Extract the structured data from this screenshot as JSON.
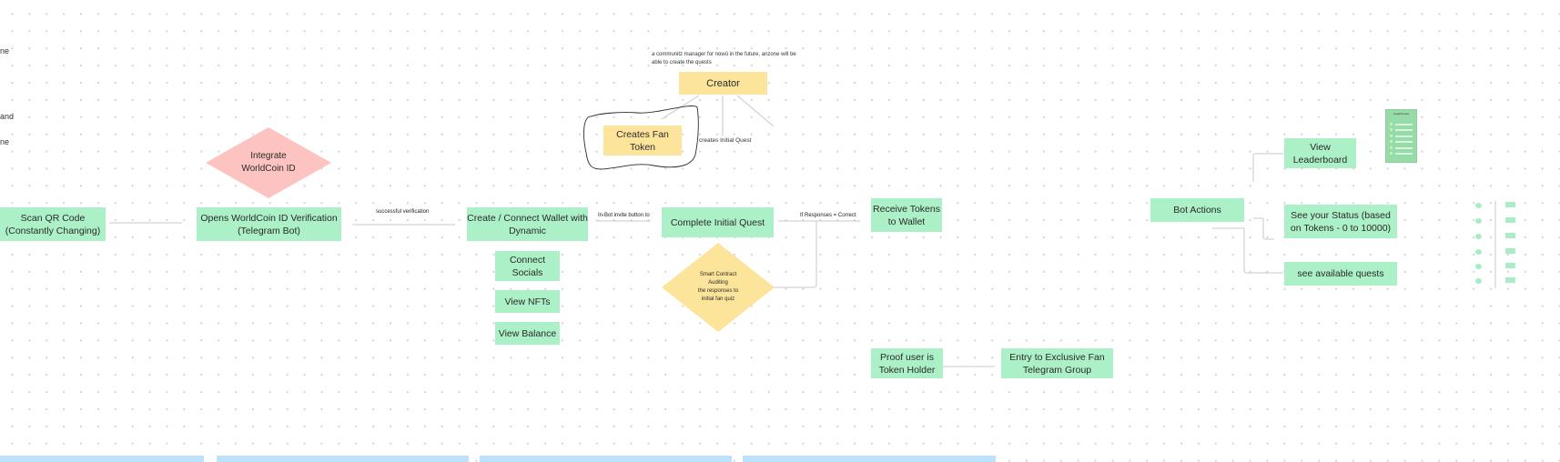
{
  "canvas": {
    "left_edge_fragments": [
      "ne",
      "and",
      "ne"
    ]
  },
  "creator": {
    "note": "a communitz manager for nowû in the future, anzone will be able to create the quests",
    "note_line1": "a communitz manager for nowû in the future, anzone will be",
    "note_line2": "able to create the quests",
    "label": "Creator",
    "creates_fan_token": "Creates Fan Token",
    "creates_fan_token_l1": "Creates Fan",
    "creates_fan_token_l2": "Token",
    "creates_initial_quest": "creates Initial Quest"
  },
  "decisions": {
    "integrate_worldcoin": {
      "l1": "Integrate",
      "l2": "WorldCoin ID"
    },
    "smart_contract": {
      "l1": "Smart Contract",
      "l2": "Auditing",
      "l3": "the responses to",
      "l4": "initial fan quiz"
    }
  },
  "flow": {
    "scan_qr": {
      "l1": "Scan QR Code",
      "l2": "(Constantly Changing)"
    },
    "open_verification": {
      "l1": "Opens WorldCoin ID Verification",
      "l2": "(Telegram Bot)"
    },
    "successful_verification": "successful verification",
    "create_wallet": {
      "l1": "Create / Connect Wallet with",
      "l2": "Dynamic"
    },
    "connect_socials": {
      "l1": "Connect",
      "l2": "Socials"
    },
    "view_nfts": "View NFTs",
    "view_balance": "View Balance",
    "in_bot_invite": "In-Bot invite button to",
    "complete_quest": "Complete Initial Quest",
    "if_correct": "If Responses = Correct",
    "receive_tokens": {
      "l1": "Receive Tokens",
      "l2": "to Wallet"
    },
    "proof_holder": {
      "l1": "Proof user is",
      "l2": "Token Holder"
    },
    "exclusive_group": {
      "l1": "Entry to Exclusive Fan",
      "l2": "Telegram Group"
    }
  },
  "bot": {
    "actions": "Bot Actions",
    "view_leaderboard": {
      "l1": "View",
      "l2": "Leaderboard"
    },
    "status": {
      "l1": "See your Status (based",
      "l2": "on Tokens - 0 to 10000)"
    },
    "quests": "see available quests",
    "leaderboard_title": "Leaderboard"
  },
  "colors": {
    "green": "#abf0c6",
    "yellow": "#fde49b",
    "pink": "#fdc3c0",
    "blue_bar": "#bde0fb"
  }
}
